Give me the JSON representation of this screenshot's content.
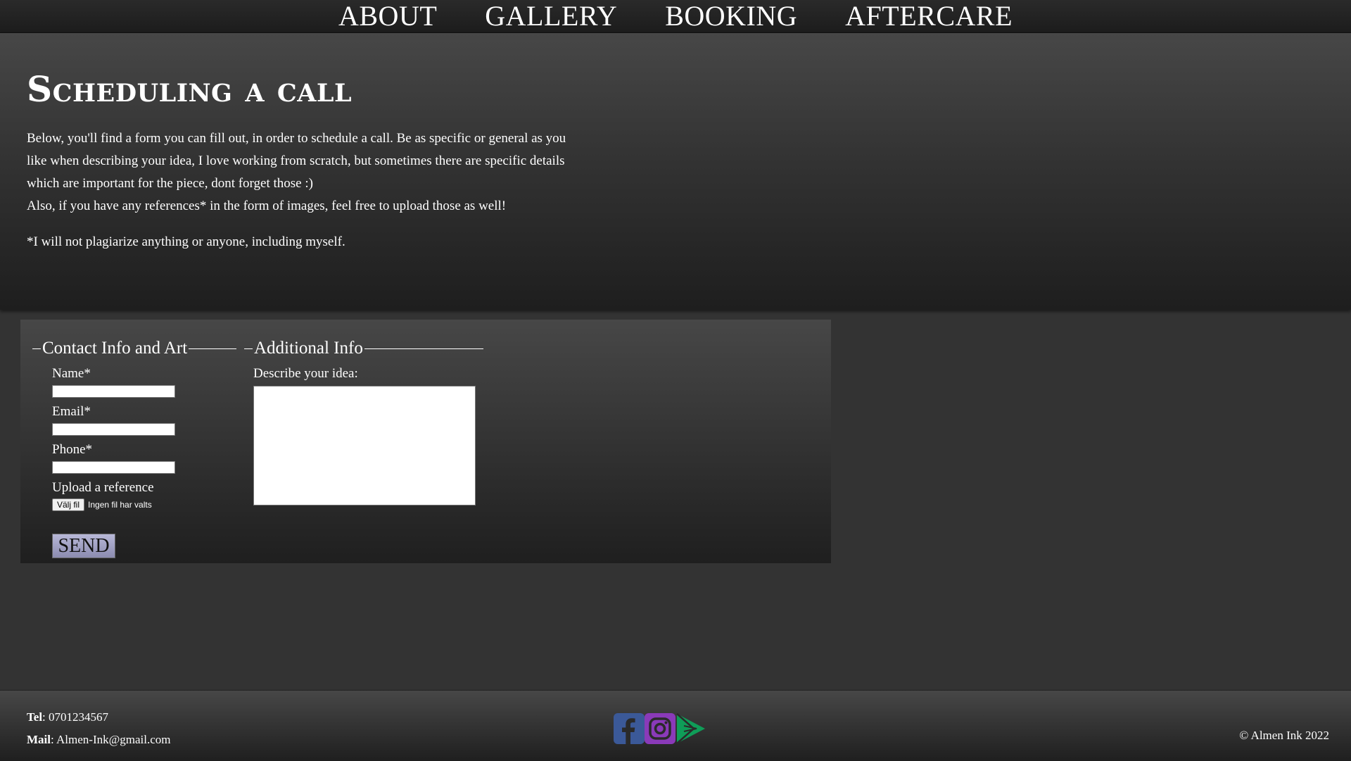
{
  "nav": {
    "items": [
      {
        "label": "ABOUT"
      },
      {
        "label": "GALLERY"
      },
      {
        "label": "BOOKING"
      },
      {
        "label": "AFTERCARE"
      }
    ]
  },
  "hero": {
    "title": "Scheduling a call",
    "intro": "Below, you'll find a form you can fill out, in order to schedule a call. Be as specific or general as you like when describing your idea, I love working from scratch, but sometimes there are specific details which are important for the piece, dont forget those :)",
    "intro2": "Also, if you have any references* in the form of images, feel free to upload those as well!",
    "note": "*I will not plagiarize anything or anyone, including myself."
  },
  "form": {
    "contact_legend": "Contact Info and Art",
    "name_label": "Name*",
    "name_value": "",
    "email_label": "Email*",
    "email_value": "",
    "phone_label": "Phone*",
    "phone_value": "",
    "upload_label": "Upload a reference",
    "file_button": "Välj fil",
    "file_status": "Ingen fil har valts",
    "send_label": "SEND",
    "additional_legend": "Additional Info",
    "idea_label": "Describe your idea:",
    "idea_value": ""
  },
  "footer": {
    "tel_label": "Tel",
    "tel_value": ": 0701234567",
    "mail_label": "Mail",
    "mail_value": ": Almen-Ink@gmail.com",
    "copyright": "© Almen Ink 2022",
    "social": [
      {
        "icon": "facebook-icon",
        "color": "#3b5998"
      },
      {
        "icon": "instagram-icon",
        "color": "#8a3ab9"
      },
      {
        "icon": "play-store-icon",
        "color": "#0f9d58"
      }
    ]
  },
  "colors": {
    "background": "#333333",
    "send_button": "#a6a6c8"
  }
}
